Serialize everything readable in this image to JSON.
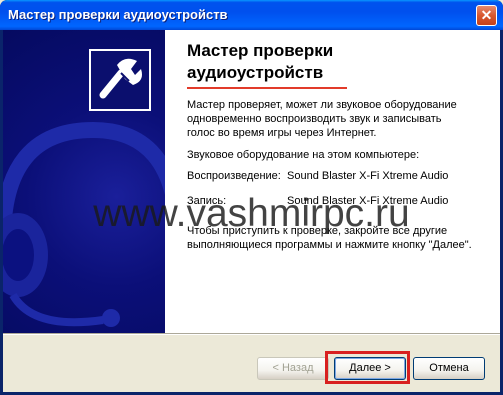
{
  "window": {
    "title": "Мастер проверки аудиоустройств",
    "close_glyph": "✕"
  },
  "content": {
    "heading_line1": "Мастер проверки",
    "heading_line2": "аудиоустройств",
    "intro": "Мастер проверяет, может ли звуковое оборудование одновременно воспроизводить звук и записывать голос во время игры через Интернет.",
    "hardware_label": "Звуковое оборудование на этом компьютере:",
    "playback_label": "Воспроизведение:",
    "playback_value": "Sound Blaster X-Fi Xtreme Audio",
    "record_label": "Запись:",
    "record_value": "Sound Blaster X-Fi Xtreme Audio",
    "instructions": "Чтобы приступить к проверке, закройте все другие выполняющиеся программы и нажмите кнопку \"Далее\"."
  },
  "watermark": "www.vashmirpc.ru",
  "buttons": {
    "back": "< Назад",
    "next": "Далее >",
    "cancel": "Отмена"
  },
  "colors": {
    "titlebar": "#0053ee",
    "left_panel": "#0b0f78",
    "underline": "#e23b2a",
    "highlight": "#d82020"
  },
  "icons": [
    "close-icon",
    "headset-wrench-icon",
    "headset-background-graphic"
  ]
}
